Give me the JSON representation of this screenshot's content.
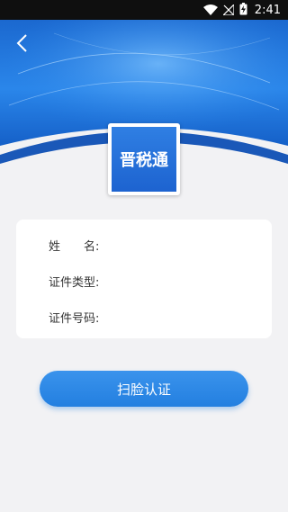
{
  "status_bar": {
    "time": "2:41",
    "icons": [
      "wifi-icon",
      "no-signal-icon",
      "battery-charging-icon"
    ]
  },
  "header": {
    "back_icon": "chevron-left-icon"
  },
  "logo": {
    "text": "晋税通"
  },
  "form": {
    "name_label": "姓　　名:",
    "name_value": "",
    "id_type_label": "证件类型:",
    "id_type_value": "",
    "id_number_label": "证件号码:",
    "id_number_value": ""
  },
  "actions": {
    "scan_face_label": "扫脸认证"
  },
  "colors": {
    "accent": "#237fe0",
    "hero_blue": "#1a6fd6",
    "background": "#f2f2f4"
  }
}
